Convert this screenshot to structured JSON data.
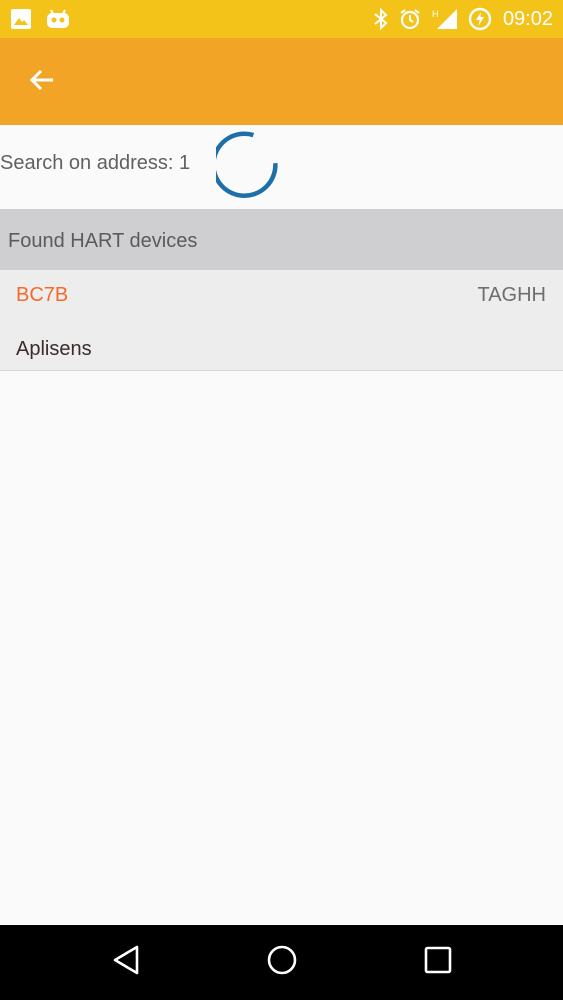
{
  "status_bar": {
    "time": "09:02",
    "network_type": "H",
    "icons": [
      "image-icon",
      "android-icon",
      "bluetooth-icon",
      "alarm-icon",
      "signal-icon",
      "battery-charging-icon"
    ],
    "background": "#f4c31a"
  },
  "app_bar": {
    "back_icon": "arrow-back-icon",
    "background": "#f2a426"
  },
  "search": {
    "label": "Search on address: 1",
    "spinner_color": "#1e6fa8"
  },
  "devices_section": {
    "title": "Found HART devices",
    "items": [
      {
        "id": "BC7B",
        "tag": "TAGHH",
        "manufacturer": "Aplisens"
      }
    ]
  },
  "colors": {
    "device_id": "#f26b2b",
    "section_header_bg": "#cfcfd1"
  },
  "nav_bar": {
    "icons": [
      "nav-back-icon",
      "nav-home-icon",
      "nav-recents-icon"
    ]
  }
}
